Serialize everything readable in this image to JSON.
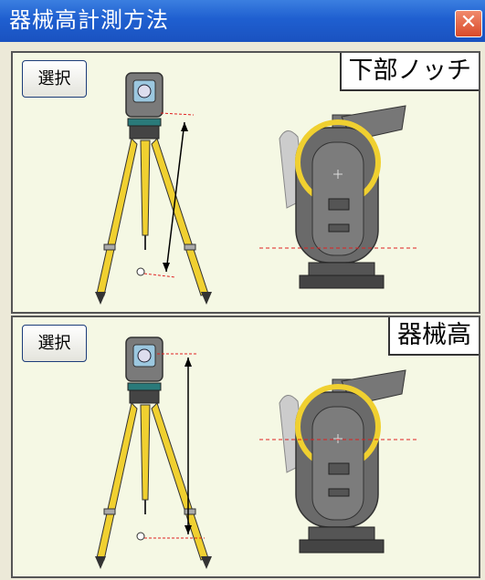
{
  "window": {
    "title": "器械高計測方法",
    "close_glyph": "✕"
  },
  "options": [
    {
      "label": "下部ノッチ",
      "select_label": "選択",
      "measure_type": "lower-notch"
    },
    {
      "label": "器械高",
      "select_label": "選択",
      "measure_type": "instrument-height"
    }
  ],
  "colors": {
    "titlebar": "#1f5fd0",
    "panel_bg": "#f5f8e4",
    "tripod_yellow": "#f0d030",
    "guide_line_red": "#e02020",
    "instrument_gray": "#6a6a6a"
  },
  "icons": [
    "close-icon",
    "tripod-instrument-icon",
    "instrument-side-view-icon"
  ]
}
